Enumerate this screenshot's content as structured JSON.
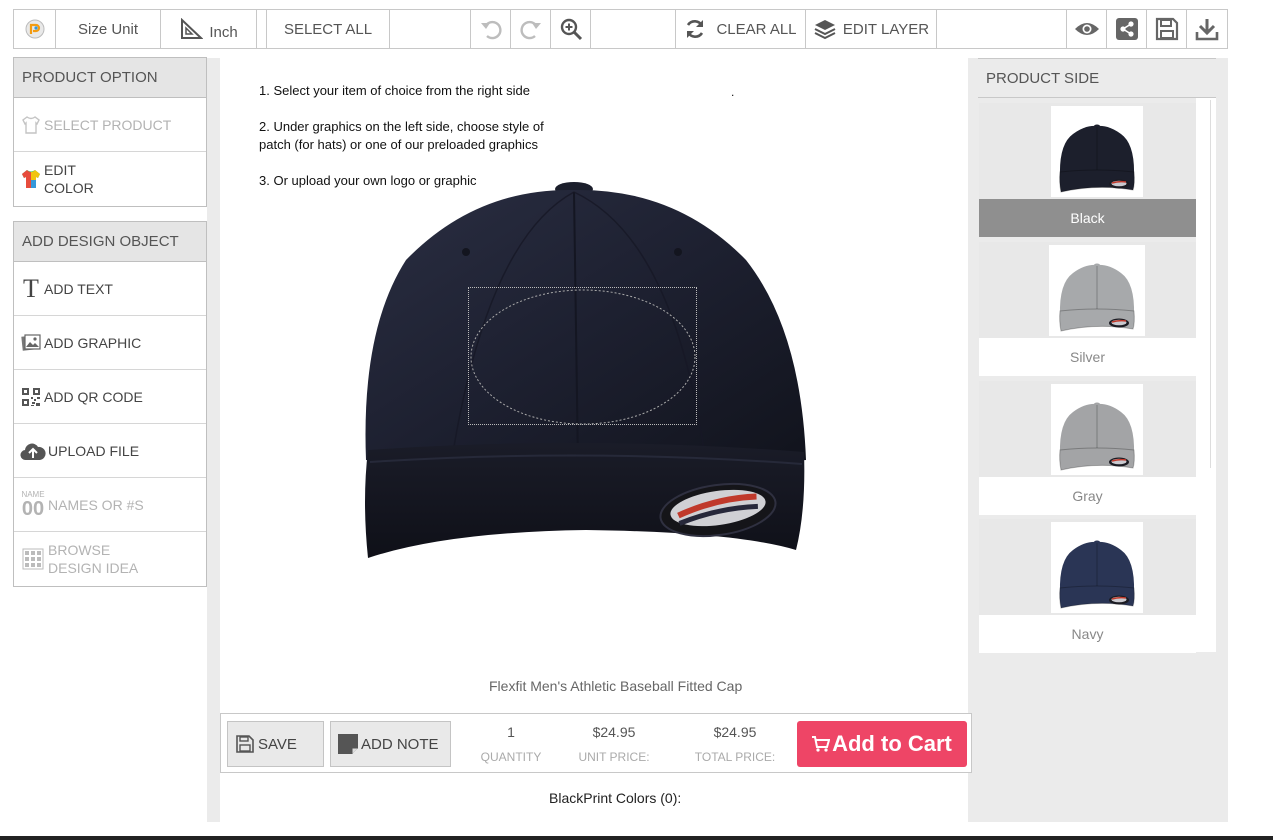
{
  "toolbar": {
    "size_unit_label": "Size Unit",
    "unit_value": "Inch",
    "select_all": "SELECT ALL",
    "clear_all": "CLEAR ALL",
    "edit_layer": "EDIT LAYER"
  },
  "product_option": {
    "title": "PRODUCT OPTION",
    "items": [
      {
        "label": "SELECT PRODUCT",
        "icon": "shirt-icon",
        "disabled": true
      },
      {
        "label_line1": "EDIT",
        "label_line2": "COLOR",
        "icon": "color-shirt-icon"
      }
    ]
  },
  "design_object": {
    "title": "ADD DESIGN OBJECT",
    "items": [
      {
        "label": "ADD TEXT",
        "icon": "text-icon"
      },
      {
        "label": "ADD GRAPHIC",
        "icon": "image-icon"
      },
      {
        "label": "ADD QR CODE",
        "icon": "qr-code-icon"
      },
      {
        "label": "UPLOAD FILE",
        "icon": "cloud-upload-icon"
      },
      {
        "label": "NAMES OR #S",
        "icon": "name-number-icon",
        "icon_text_top": "NAME",
        "icon_text_bottom": "00",
        "disabled": true
      },
      {
        "label_line1": "BROWSE",
        "label_line2": "DESIGN IDEA",
        "icon": "grid-icon",
        "disabled": true
      }
    ]
  },
  "instructions": [
    "1.  Select your item of choice from the right side",
    "2.  Under graphics on the left side, choose style of patch (for hats) or one of our preloaded graphics",
    "3.  Or upload your own logo or graphic"
  ],
  "stray_dot": ".",
  "product_name": "Flexfit Men's Athletic Baseball Fitted Cap",
  "bottom_bar": {
    "save": "SAVE",
    "add_note": "ADD NOTE",
    "quantity_value": "1",
    "quantity_label": "QUANTITY",
    "unit_price_value": "$24.95",
    "unit_price_label": "UNIT PRICE:",
    "total_price_value": "$24.95",
    "total_price_label": "TOTAL PRICE:",
    "add_to_cart": "Add to Cart"
  },
  "blackprint_colors": "BlackPrint Colors  (0):",
  "product_side": {
    "title": "PRODUCT SIDE",
    "items": [
      {
        "label": "Black",
        "color": "#1c1f2c",
        "active": true
      },
      {
        "label": "Silver",
        "color": "#a7a9ab"
      },
      {
        "label": "Gray",
        "color": "#a3a4a6"
      },
      {
        "label": "Navy",
        "color": "#2a3555"
      }
    ]
  },
  "colors": {
    "cart_button": "#ee4566",
    "panel_header": "#e5e5e5",
    "cap": "#1d2030"
  }
}
